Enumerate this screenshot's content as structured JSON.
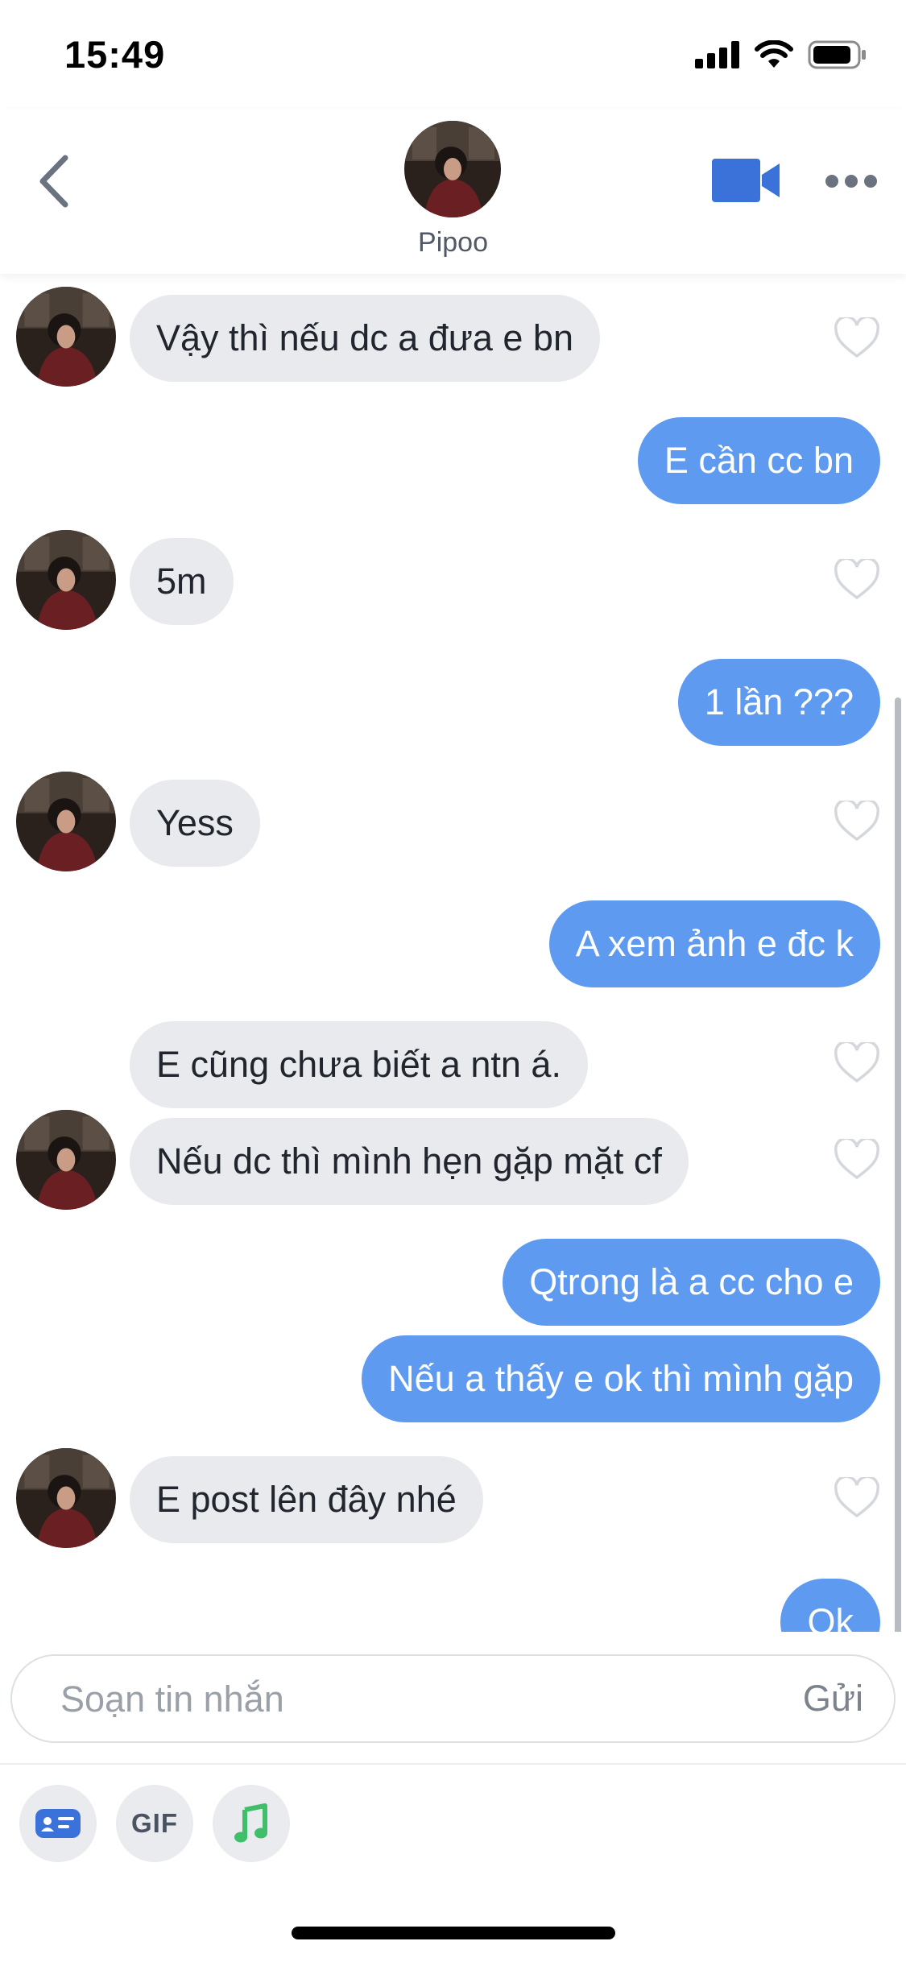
{
  "status_bar": {
    "time": "15:49"
  },
  "header": {
    "name": "Pipoo"
  },
  "messages": [
    {
      "dir": "in",
      "text": "Vậy thì nếu dc a đưa e bn"
    },
    {
      "dir": "out",
      "text": "E cần cc bn"
    },
    {
      "dir": "in",
      "text": "5m"
    },
    {
      "dir": "out",
      "text": "1 lần ???"
    },
    {
      "dir": "in",
      "text": "Yess"
    },
    {
      "dir": "out",
      "text": "A xem ảnh e đc k"
    },
    {
      "dir": "in",
      "text": "E cũng chưa biết a ntn á."
    },
    {
      "dir": "in",
      "text": "Nếu dc thì mình hẹn gặp mặt cf"
    },
    {
      "dir": "out",
      "text": "Qtrong là a cc cho e"
    },
    {
      "dir": "out",
      "text": "Nếu a thấy e ok thì mình gặp"
    },
    {
      "dir": "in",
      "text": "E post lên đây nhé"
    },
    {
      "dir": "out",
      "text": "Ok"
    }
  ],
  "composer": {
    "placeholder": "Soạn tin nhắn",
    "send_label": "Gửi",
    "tools": {
      "gif_label": "GIF"
    }
  },
  "colors": {
    "outgoing_bubble": "#5e9af0",
    "incoming_bubble": "#e9eaee",
    "video_icon": "#3b72d9",
    "music_icon": "#3fbf6a"
  },
  "icons": [
    "back-chevron-icon",
    "video-camera-icon",
    "more-dots-icon",
    "heart-icon",
    "contact-card-icon",
    "music-note-icon"
  ]
}
